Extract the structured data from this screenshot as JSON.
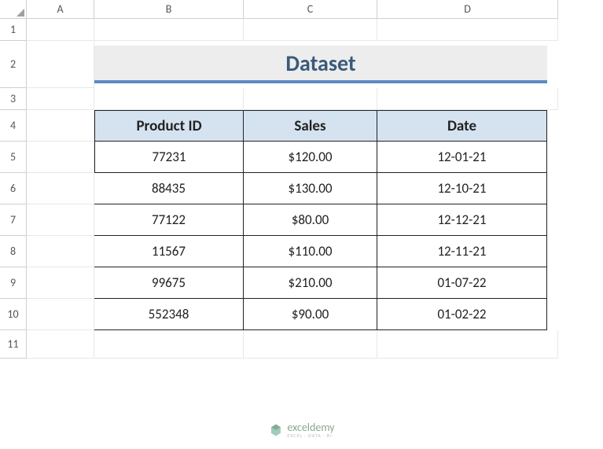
{
  "columns": [
    "A",
    "B",
    "C",
    "D"
  ],
  "rows": [
    "1",
    "2",
    "3",
    "4",
    "5",
    "6",
    "7",
    "8",
    "9",
    "10",
    "11"
  ],
  "title": "Dataset",
  "headers": {
    "col1": "Product ID",
    "col2": "Sales",
    "col3": "Date"
  },
  "chart_data": {
    "type": "table",
    "columns": [
      "Product ID",
      "Sales",
      "Date"
    ],
    "rows": [
      {
        "product_id": "77231",
        "sales": "$120.00",
        "date": "12-01-21"
      },
      {
        "product_id": "88435",
        "sales": "$130.00",
        "date": "12-10-21"
      },
      {
        "product_id": "77122",
        "sales": "$80.00",
        "date": "12-12-21"
      },
      {
        "product_id": "11567",
        "sales": "$110.00",
        "date": "12-11-21"
      },
      {
        "product_id": "99675",
        "sales": "$210.00",
        "date": "01-07-22"
      },
      {
        "product_id": "552348",
        "sales": "$90.00",
        "date": "01-02-22"
      }
    ]
  },
  "watermark": {
    "main": "exceldemy",
    "sub": "EXCEL · DATA · BI"
  }
}
